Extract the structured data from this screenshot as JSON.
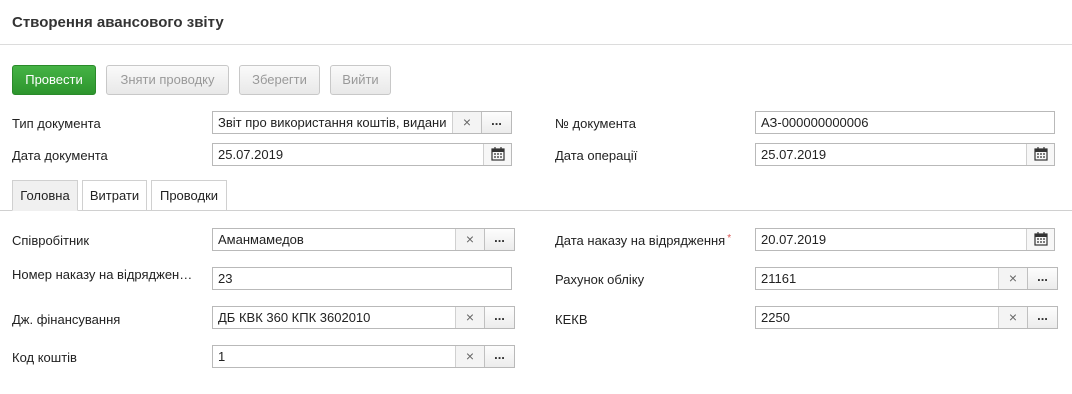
{
  "page": {
    "title": "Створення авансового звіту"
  },
  "toolbar": {
    "post": "Провести",
    "unpost": "Зняти проводку",
    "save": "Зберегти",
    "exit": "Вийти"
  },
  "header": {
    "doc_type": {
      "label": "Тип документа",
      "value": "Звіт про використання коштів, видани"
    },
    "doc_number": {
      "label": "№ документа",
      "value": "АЗ-000000000006"
    },
    "doc_date": {
      "label": "Дата документа",
      "value": "25.07.2019"
    },
    "op_date": {
      "label": "Дата операції",
      "value": "25.07.2019"
    }
  },
  "tabs": [
    {
      "label": "Головна",
      "active": true
    },
    {
      "label": "Витрати",
      "active": false
    },
    {
      "label": "Проводки",
      "active": false
    }
  ],
  "main": {
    "employee": {
      "label": "Співробітник",
      "value": "Аманмамедов"
    },
    "order_number": {
      "label": "Номер наказу на відрядження",
      "display_label": "Номер наказу на відряджен…",
      "value": "23"
    },
    "funding": {
      "label": "Дж. фінансування",
      "value": "ДБ КВК 360 КПК 3602010"
    },
    "fund_code": {
      "label": "Код коштів",
      "value": "1"
    },
    "order_date": {
      "label": "Дата наказу на відрядження",
      "required_mark": "*",
      "value": "20.07.2019"
    },
    "account": {
      "label": "Рахунок обліку",
      "value": "21161"
    },
    "kekv": {
      "label": "КЕКВ",
      "value": "2250"
    }
  },
  "icons": {
    "clear": "×",
    "more": "...",
    "calendar": "calendar-icon"
  },
  "colors": {
    "primary_button": "#2d952d"
  }
}
